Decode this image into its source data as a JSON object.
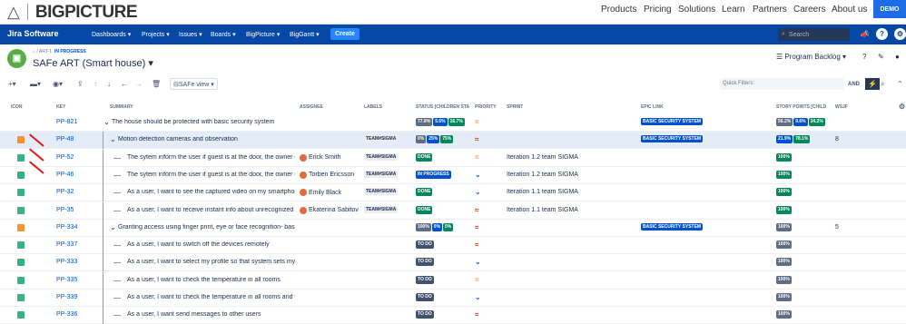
{
  "site": {
    "logo_text": "BIGPICTURE",
    "nav": [
      "Products",
      "Pricing",
      "Solutions",
      "Learn",
      "Partners",
      "Careers",
      "About us"
    ],
    "demo": "DEMO"
  },
  "jira": {
    "brand": "Jira Software",
    "nav": [
      "Dashboards ▾",
      "Projects ▾",
      "Issues ▾",
      "Boards ▾",
      "BigPicture ▾",
      "BigGantt ▾"
    ],
    "create": "Create",
    "search_placeholder": "Search"
  },
  "project": {
    "breadcrumb": "/ ART-1",
    "status": "IN PROGRESS",
    "title": "SAFe ART (Smart house) ▾",
    "view": "Program Backlog ▾"
  },
  "toolbar": {
    "view": "SAFe view ▾",
    "quick_filters": "Quick Filters:",
    "and": "AND"
  },
  "columns": [
    "ICON",
    "KEY",
    "SUMMARY",
    "ASSIGNEE",
    "LABELS",
    "STATUS [CHILDREN STA",
    "PRIORITY",
    "SPRINT",
    "EPIC LINK",
    "STORY POINTS [CHILD",
    "WSJF"
  ],
  "rows": [
    {
      "type": "epic",
      "key": "PP-821",
      "summary": "The house should be protected with basic security system",
      "assignee": "",
      "label": "",
      "status": [
        [
          "77.8%",
          "gr"
        ],
        [
          "5.6%",
          "b"
        ],
        [
          "16.7%",
          "g"
        ]
      ],
      "priority": "=",
      "pri_color": "#f79232",
      "sprint": "",
      "epic": "BASIC SECURITY SYSTEM",
      "sp": [
        [
          "56.2%",
          "gr"
        ],
        [
          "9.6%",
          "b"
        ],
        [
          "34.2%",
          "g"
        ]
      ],
      "wsjf": ""
    },
    {
      "type": "feat",
      "key": "PP-48",
      "summary": "Motion detection cameras and observation",
      "assignee": "",
      "label": "TEAM#SIGMA",
      "status": [
        [
          "0%",
          "gr"
        ],
        [
          "25%",
          "b"
        ],
        [
          "75%",
          "g"
        ]
      ],
      "priority": "≈",
      "pri_color": "#de350b",
      "sprint": "",
      "epic": "BASIC SECURITY SYSTEM",
      "sp": [
        [
          "21.9%",
          "b"
        ],
        [
          "78.1%",
          "g"
        ]
      ],
      "wsjf": "8"
    },
    {
      "type": "story",
      "key": "PP-52",
      "summary": "The sytem inform the user if guest is at the door, the owner can",
      "assignee": "Erick Smith",
      "label": "TEAM#SIGMA",
      "status": [
        [
          "DONE",
          "g"
        ]
      ],
      "priority": "=",
      "pri_color": "#f79232",
      "sprint": "Iteration 1.2 team SIGMA",
      "epic": "",
      "sp": [
        [
          "100%",
          "g"
        ]
      ],
      "wsjf": ""
    },
    {
      "type": "story",
      "key": "PP-46",
      "summary": "The sytem inform the user if guest is at the door, the owner can",
      "assignee": "Torben Ericsson",
      "label": "TEAM#SIGMA",
      "status": [
        [
          "IN PROGRESS",
          "b"
        ]
      ],
      "priority": "⌄",
      "pri_color": "#0065ff",
      "sprint": "Iteration 1.2 team SIGMA",
      "epic": "",
      "sp": [
        [
          "100%",
          "g"
        ]
      ],
      "wsjf": ""
    },
    {
      "type": "story",
      "key": "PP-32",
      "summary": "As a user, I want to see the captured video on my smartphone",
      "assignee": "Emily Black",
      "label": "TEAM#SIGMA",
      "status": [
        [
          "DONE",
          "g"
        ]
      ],
      "priority": "⌄",
      "pri_color": "#0065ff",
      "sprint": "Iteration 1.1 team SIGMA",
      "epic": "",
      "sp": [
        [
          "100%",
          "g"
        ]
      ],
      "wsjf": ""
    },
    {
      "type": "story",
      "key": "PP-35",
      "summary": "As a user, I want to receive instant info about unrecognized by th",
      "assignee": "Ekaterina Sabitov",
      "label": "TEAM#SIGMA",
      "status": [
        [
          "DONE",
          "g"
        ]
      ],
      "priority": "≈",
      "pri_color": "#de350b",
      "sprint": "Iteration 1.1 team SIGMA",
      "epic": "",
      "sp": [
        [
          "100%",
          "g"
        ]
      ],
      "wsjf": ""
    },
    {
      "type": "feat",
      "key": "PP-334",
      "summary": "Granting access using finger print, eye or face recognition- basic",
      "assignee": "",
      "label": "",
      "status": [
        [
          "100%",
          "gr"
        ],
        [
          "0%",
          "b"
        ],
        [
          "0%",
          "g"
        ]
      ],
      "priority": "≈",
      "pri_color": "#de350b",
      "sprint": "",
      "epic": "BASIC SECURITY SYSTEM",
      "sp": [
        [
          "100%",
          "gr"
        ]
      ],
      "wsjf": "5"
    },
    {
      "type": "story",
      "key": "PP-337",
      "summary": "As a user, I want to switch off the devices remotely",
      "assignee": "",
      "label": "",
      "status": [
        [
          "TO DO",
          "d"
        ]
      ],
      "priority": "≈",
      "pri_color": "#de350b",
      "sprint": "",
      "epic": "",
      "sp": [
        [
          "100%",
          "gr"
        ]
      ],
      "wsjf": ""
    },
    {
      "type": "story",
      "key": "PP-333",
      "summary": "As a user, I want to select my profile so that system sets my fav",
      "assignee": "",
      "label": "",
      "status": [
        [
          "TO DO",
          "d"
        ]
      ],
      "priority": "⌄",
      "pri_color": "#0065ff",
      "sprint": "",
      "epic": "",
      "sp": [
        [
          "100%",
          "gr"
        ]
      ],
      "wsjf": ""
    },
    {
      "type": "story",
      "key": "PP-335",
      "summary": "As a user, I want to check the temperature in all rooms",
      "assignee": "",
      "label": "",
      "status": [
        [
          "TO DO",
          "d"
        ]
      ],
      "priority": "=",
      "pri_color": "#f79232",
      "sprint": "",
      "epic": "",
      "sp": [
        [
          "100%",
          "gr"
        ]
      ],
      "wsjf": ""
    },
    {
      "type": "story",
      "key": "PP-339",
      "summary": "As a user, I want to check the temperature in all rooms and the s",
      "assignee": "",
      "label": "",
      "status": [
        [
          "TO DO",
          "d"
        ]
      ],
      "priority": "⌄",
      "pri_color": "#0065ff",
      "sprint": "",
      "epic": "",
      "sp": [
        [
          "100%",
          "gr"
        ]
      ],
      "wsjf": ""
    },
    {
      "type": "story",
      "key": "PP-336",
      "summary": "As a user, I want send messages to other users",
      "assignee": "",
      "label": "",
      "status": [
        [
          "TO DO",
          "d"
        ]
      ],
      "priority": "≈",
      "pri_color": "#de350b",
      "sprint": "",
      "epic": "",
      "sp": [
        [
          "100%",
          "gr"
        ]
      ],
      "wsjf": ""
    }
  ]
}
